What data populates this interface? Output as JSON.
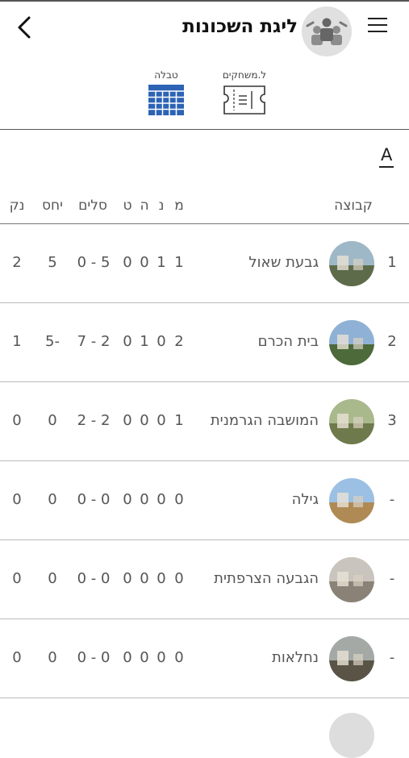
{
  "header": {
    "title": "ליגת השכונות"
  },
  "tabs": [
    {
      "label": "טבלה"
    },
    {
      "label": "ל.משחקים"
    }
  ],
  "filter": {
    "label": "A"
  },
  "columns": {
    "team": "קבוצה",
    "m": "מ",
    "n": "נ",
    "h": "ה",
    "t": "ט",
    "goals": "סלים",
    "ratio": "יחס",
    "points": "נק"
  },
  "rows": [
    {
      "rank": "1",
      "team": "גבעת שאול",
      "m": "1",
      "n": "1",
      "h": "0",
      "t": "0",
      "goals": "5 - 0",
      "ratio": "5",
      "points": "2",
      "img_top": "#9fb8c8",
      "img_bottom": "#5d6b4a"
    },
    {
      "rank": "2",
      "team": "בית הכרם",
      "m": "2",
      "n": "0",
      "h": "1",
      "t": "0",
      "goals": "2 - 7",
      "ratio": "-5",
      "points": "1",
      "img_top": "#8fb1d6",
      "img_bottom": "#4c6a3a"
    },
    {
      "rank": "3",
      "team": "המושבה הגרמנית",
      "m": "1",
      "n": "0",
      "h": "0",
      "t": "0",
      "goals": "2 - 2",
      "ratio": "0",
      "points": "0",
      "img_top": "#a9b98c",
      "img_bottom": "#6f7a4c"
    },
    {
      "rank": "-",
      "team": "גילה",
      "m": "0",
      "n": "0",
      "h": "0",
      "t": "0",
      "goals": "0 - 0",
      "ratio": "0",
      "points": "0",
      "img_top": "#9cc0e4",
      "img_bottom": "#b08a55"
    },
    {
      "rank": "-",
      "team": "הגבעה הצרפתית",
      "m": "0",
      "n": "0",
      "h": "0",
      "t": "0",
      "goals": "0 - 0",
      "ratio": "0",
      "points": "0",
      "img_top": "#c9c4bd",
      "img_bottom": "#8a8276"
    },
    {
      "rank": "-",
      "team": "נחלאות",
      "m": "0",
      "n": "0",
      "h": "0",
      "t": "0",
      "goals": "0 - 0",
      "ratio": "0",
      "points": "0",
      "img_top": "#a4a9a6",
      "img_bottom": "#5a5447"
    }
  ]
}
